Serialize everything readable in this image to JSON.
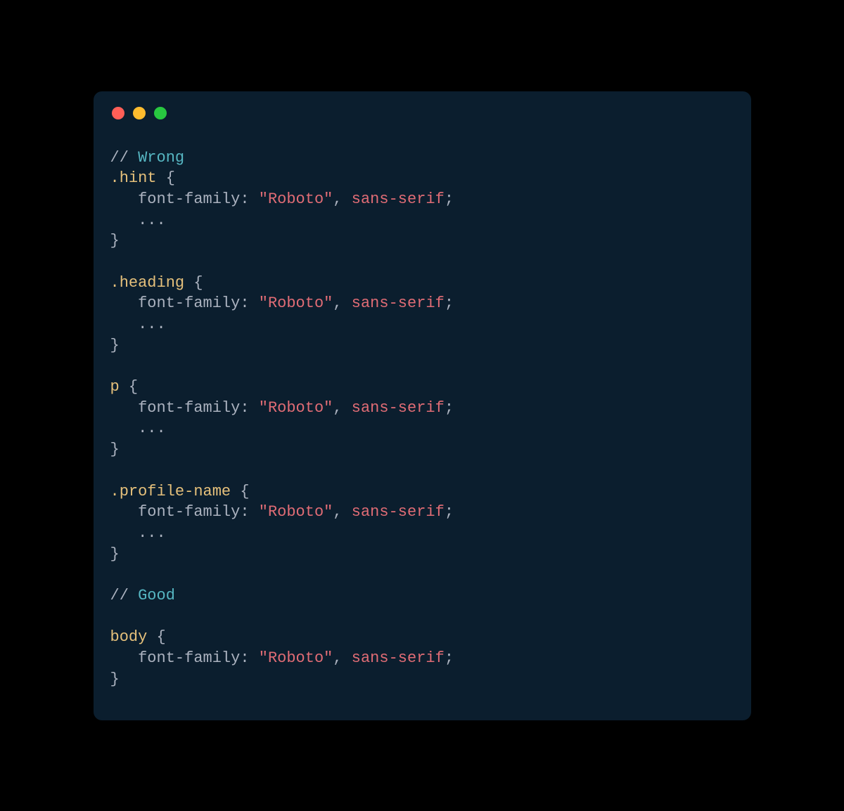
{
  "colors": {
    "background": "#000000",
    "window": "#0b1e2e",
    "dot_red": "#ff5f57",
    "dot_yellow": "#febc2e",
    "dot_green": "#28c840",
    "comment": "#56b6c2",
    "selector": "#e5c07b",
    "default": "#abb2bf",
    "string": "#e06c75"
  },
  "code": {
    "lines": [
      {
        "type": "comment",
        "slashes": "// ",
        "word": "Wrong"
      },
      {
        "type": "selector_open",
        "selector": ".hint",
        "space": " ",
        "brace": "{"
      },
      {
        "type": "declaration",
        "indent": "   ",
        "property": "font-family",
        "colon": ": ",
        "string": "\"Roboto\"",
        "comma": ", ",
        "keyword": "sans-serif",
        "semicolon": ";"
      },
      {
        "type": "ellipsis",
        "indent": "   ",
        "text": "..."
      },
      {
        "type": "close",
        "brace": "}"
      },
      {
        "type": "blank"
      },
      {
        "type": "selector_open",
        "selector": ".heading",
        "space": " ",
        "brace": "{"
      },
      {
        "type": "declaration",
        "indent": "   ",
        "property": "font-family",
        "colon": ": ",
        "string": "\"Roboto\"",
        "comma": ", ",
        "keyword": "sans-serif",
        "semicolon": ";"
      },
      {
        "type": "ellipsis",
        "indent": "   ",
        "text": "..."
      },
      {
        "type": "close",
        "brace": "}"
      },
      {
        "type": "blank"
      },
      {
        "type": "selector_open",
        "selector": "p",
        "space": " ",
        "brace": "{"
      },
      {
        "type": "declaration",
        "indent": "   ",
        "property": "font-family",
        "colon": ": ",
        "string": "\"Roboto\"",
        "comma": ", ",
        "keyword": "sans-serif",
        "semicolon": ";"
      },
      {
        "type": "ellipsis",
        "indent": "   ",
        "text": "..."
      },
      {
        "type": "close",
        "brace": "}"
      },
      {
        "type": "blank"
      },
      {
        "type": "selector_open",
        "selector": ".profile-name",
        "space": " ",
        "brace": "{"
      },
      {
        "type": "declaration",
        "indent": "   ",
        "property": "font-family",
        "colon": ": ",
        "string": "\"Roboto\"",
        "comma": ", ",
        "keyword": "sans-serif",
        "semicolon": ";"
      },
      {
        "type": "ellipsis",
        "indent": "   ",
        "text": "..."
      },
      {
        "type": "close",
        "brace": "}"
      },
      {
        "type": "blank"
      },
      {
        "type": "comment",
        "slashes": "// ",
        "word": "Good"
      },
      {
        "type": "blank"
      },
      {
        "type": "selector_open",
        "selector": "body",
        "space": " ",
        "brace": "{"
      },
      {
        "type": "declaration",
        "indent": "   ",
        "property": "font-family",
        "colon": ": ",
        "string": "\"Roboto\"",
        "comma": ", ",
        "keyword": "sans-serif",
        "semicolon": ";"
      },
      {
        "type": "close",
        "brace": "}"
      }
    ]
  }
}
